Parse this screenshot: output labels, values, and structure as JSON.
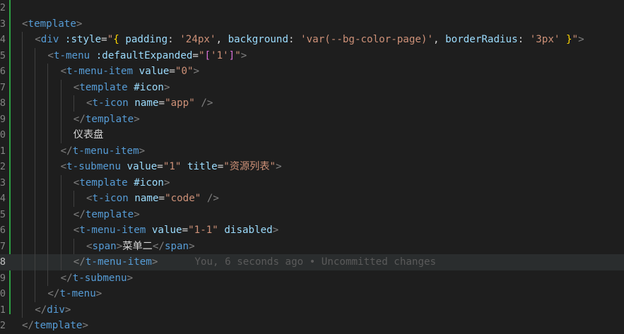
{
  "editor": {
    "line_numbers": [
      "2",
      "3",
      "4",
      "5",
      "6",
      "7",
      "8",
      "9",
      "0",
      "1",
      "2",
      "3",
      "4",
      "5",
      "6",
      "7",
      "8",
      "9",
      "0",
      "1",
      "2"
    ],
    "current_line_index": 16,
    "blame": "You, 6 seconds ago • Uncommitted changes",
    "git_change_color": "#2ea043"
  },
  "lines": [
    {
      "indent": 0,
      "tokens": []
    },
    {
      "indent": 0,
      "tokens": [
        {
          "t": "<",
          "c": "punc"
        },
        {
          "t": "template",
          "c": "tag"
        },
        {
          "t": ">",
          "c": "punc"
        }
      ]
    },
    {
      "indent": 1,
      "tokens": [
        {
          "t": "<",
          "c": "punc"
        },
        {
          "t": "div",
          "c": "tag"
        },
        {
          "t": " ",
          "c": "text"
        },
        {
          "t": ":style",
          "c": "attr"
        },
        {
          "t": "=",
          "c": "text"
        },
        {
          "t": "\"",
          "c": "str"
        },
        {
          "t": "{",
          "c": "yellow"
        },
        {
          "t": " ",
          "c": "text"
        },
        {
          "t": "padding",
          "c": "attr"
        },
        {
          "t": ": ",
          "c": "text"
        },
        {
          "t": "'24px'",
          "c": "str"
        },
        {
          "t": ", ",
          "c": "text"
        },
        {
          "t": "background",
          "c": "attr"
        },
        {
          "t": ": ",
          "c": "text"
        },
        {
          "t": "'var(--bg-color-page)'",
          "c": "str"
        },
        {
          "t": ", ",
          "c": "text"
        },
        {
          "t": "borderRadius",
          "c": "attr"
        },
        {
          "t": ": ",
          "c": "text"
        },
        {
          "t": "'3px'",
          "c": "str"
        },
        {
          "t": " ",
          "c": "text"
        },
        {
          "t": "}",
          "c": "yellow"
        },
        {
          "t": "\"",
          "c": "str"
        },
        {
          "t": ">",
          "c": "punc"
        }
      ]
    },
    {
      "indent": 2,
      "tokens": [
        {
          "t": "<",
          "c": "punc"
        },
        {
          "t": "t-menu",
          "c": "tag"
        },
        {
          "t": " ",
          "c": "text"
        },
        {
          "t": ":defaultExpanded",
          "c": "attr"
        },
        {
          "t": "=",
          "c": "text"
        },
        {
          "t": "\"",
          "c": "str"
        },
        {
          "t": "[",
          "c": "magenta"
        },
        {
          "t": "'1'",
          "c": "str"
        },
        {
          "t": "]",
          "c": "magenta"
        },
        {
          "t": "\"",
          "c": "str"
        },
        {
          "t": ">",
          "c": "punc"
        }
      ]
    },
    {
      "indent": 3,
      "tokens": [
        {
          "t": "<",
          "c": "punc"
        },
        {
          "t": "t-menu-item",
          "c": "tag"
        },
        {
          "t": " ",
          "c": "text"
        },
        {
          "t": "value",
          "c": "attr"
        },
        {
          "t": "=",
          "c": "text"
        },
        {
          "t": "\"0\"",
          "c": "str"
        },
        {
          "t": ">",
          "c": "punc"
        }
      ]
    },
    {
      "indent": 4,
      "tokens": [
        {
          "t": "<",
          "c": "punc"
        },
        {
          "t": "template",
          "c": "tag"
        },
        {
          "t": " ",
          "c": "text"
        },
        {
          "t": "#icon",
          "c": "attr"
        },
        {
          "t": ">",
          "c": "punc"
        }
      ]
    },
    {
      "indent": 5,
      "tokens": [
        {
          "t": "<",
          "c": "punc"
        },
        {
          "t": "t-icon",
          "c": "tag"
        },
        {
          "t": " ",
          "c": "text"
        },
        {
          "t": "name",
          "c": "attr"
        },
        {
          "t": "=",
          "c": "text"
        },
        {
          "t": "\"app\"",
          "c": "str"
        },
        {
          "t": " />",
          "c": "punc"
        }
      ]
    },
    {
      "indent": 4,
      "tokens": [
        {
          "t": "</",
          "c": "punc"
        },
        {
          "t": "template",
          "c": "tag"
        },
        {
          "t": ">",
          "c": "punc"
        }
      ]
    },
    {
      "indent": 4,
      "tokens": [
        {
          "t": "仪表盘",
          "c": "text"
        }
      ]
    },
    {
      "indent": 3,
      "tokens": [
        {
          "t": "</",
          "c": "punc"
        },
        {
          "t": "t-menu-item",
          "c": "tag"
        },
        {
          "t": ">",
          "c": "punc"
        }
      ]
    },
    {
      "indent": 3,
      "tokens": [
        {
          "t": "<",
          "c": "punc"
        },
        {
          "t": "t-submenu",
          "c": "tag"
        },
        {
          "t": " ",
          "c": "text"
        },
        {
          "t": "value",
          "c": "attr"
        },
        {
          "t": "=",
          "c": "text"
        },
        {
          "t": "\"1\"",
          "c": "str"
        },
        {
          "t": " ",
          "c": "text"
        },
        {
          "t": "title",
          "c": "attr"
        },
        {
          "t": "=",
          "c": "text"
        },
        {
          "t": "\"资源列表\"",
          "c": "str"
        },
        {
          "t": ">",
          "c": "punc"
        }
      ]
    },
    {
      "indent": 4,
      "tokens": [
        {
          "t": "<",
          "c": "punc"
        },
        {
          "t": "template",
          "c": "tag"
        },
        {
          "t": " ",
          "c": "text"
        },
        {
          "t": "#icon",
          "c": "attr"
        },
        {
          "t": ">",
          "c": "punc"
        }
      ]
    },
    {
      "indent": 5,
      "tokens": [
        {
          "t": "<",
          "c": "punc"
        },
        {
          "t": "t-icon",
          "c": "tag"
        },
        {
          "t": " ",
          "c": "text"
        },
        {
          "t": "name",
          "c": "attr"
        },
        {
          "t": "=",
          "c": "text"
        },
        {
          "t": "\"code\"",
          "c": "str"
        },
        {
          "t": " />",
          "c": "punc"
        }
      ]
    },
    {
      "indent": 4,
      "tokens": [
        {
          "t": "</",
          "c": "punc"
        },
        {
          "t": "template",
          "c": "tag"
        },
        {
          "t": ">",
          "c": "punc"
        }
      ]
    },
    {
      "indent": 4,
      "tokens": [
        {
          "t": "<",
          "c": "punc"
        },
        {
          "t": "t-menu-item",
          "c": "tag"
        },
        {
          "t": " ",
          "c": "text"
        },
        {
          "t": "value",
          "c": "attr"
        },
        {
          "t": "=",
          "c": "text"
        },
        {
          "t": "\"1-1\"",
          "c": "str"
        },
        {
          "t": " ",
          "c": "text"
        },
        {
          "t": "disabled",
          "c": "attr"
        },
        {
          "t": ">",
          "c": "punc"
        }
      ]
    },
    {
      "indent": 5,
      "tokens": [
        {
          "t": "<",
          "c": "punc"
        },
        {
          "t": "span",
          "c": "tag"
        },
        {
          "t": ">",
          "c": "punc"
        },
        {
          "t": "菜单二",
          "c": "text"
        },
        {
          "t": "</",
          "c": "punc"
        },
        {
          "t": "span",
          "c": "tag"
        },
        {
          "t": ">",
          "c": "punc"
        }
      ]
    },
    {
      "indent": 4,
      "blame": true,
      "tokens": [
        {
          "t": "</",
          "c": "punc"
        },
        {
          "t": "t-menu-item",
          "c": "tag"
        },
        {
          "t": ">",
          "c": "punc"
        }
      ]
    },
    {
      "indent": 3,
      "tokens": [
        {
          "t": "</",
          "c": "punc"
        },
        {
          "t": "t-submenu",
          "c": "tag"
        },
        {
          "t": ">",
          "c": "punc"
        }
      ]
    },
    {
      "indent": 2,
      "tokens": [
        {
          "t": "</",
          "c": "punc"
        },
        {
          "t": "t-menu",
          "c": "tag"
        },
        {
          "t": ">",
          "c": "punc"
        }
      ]
    },
    {
      "indent": 1,
      "tokens": [
        {
          "t": "</",
          "c": "punc"
        },
        {
          "t": "div",
          "c": "tag"
        },
        {
          "t": ">",
          "c": "punc"
        }
      ]
    },
    {
      "indent": 0,
      "tokens": [
        {
          "t": "</",
          "c": "punc"
        },
        {
          "t": "template",
          "c": "tag"
        },
        {
          "t": ">",
          "c": "punc"
        }
      ]
    }
  ]
}
